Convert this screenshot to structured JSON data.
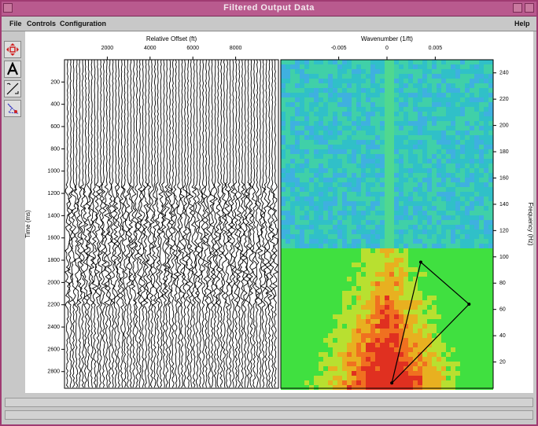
{
  "window": {
    "title": "Filtered Output Data"
  },
  "menu": {
    "file": "File",
    "controls": "Controls",
    "configuration": "Configuration",
    "help": "Help"
  },
  "toolbar": {
    "tools": [
      {
        "name": "pan-tool",
        "icon": "move-arrows-icon"
      },
      {
        "name": "annotate-tool",
        "icon": "letter-a-icon"
      },
      {
        "name": "line-tool",
        "icon": "line-draw-icon"
      },
      {
        "name": "polygon-tool",
        "icon": "polygon-select-icon"
      }
    ]
  },
  "chart_data": [
    {
      "type": "seismic-wiggle",
      "xlabel": "Relative Offset (ft)",
      "ylabel": "Time (ms)",
      "x_ticks": [
        2000,
        4000,
        6000,
        8000
      ],
      "y_ticks": [
        200,
        400,
        600,
        800,
        1000,
        1200,
        1400,
        1600,
        1800,
        2000,
        2200,
        2400,
        2600,
        2800
      ],
      "ylim": [
        0,
        2950
      ],
      "xlim": [
        0,
        10000
      ]
    },
    {
      "type": "heatmap",
      "xlabel": "Wavenumber (1/ft)",
      "ylabel": "Frequency (Hz)",
      "x_ticks": [
        "-0.005",
        "0",
        "0.005"
      ],
      "y_ticks": [
        240,
        220,
        200,
        180,
        160,
        140,
        120,
        100,
        80,
        60,
        40,
        20
      ],
      "xlim": [
        -0.011,
        0.011
      ],
      "ylim": [
        0,
        250
      ],
      "filter_polygon": [
        [
          0.0005,
          4
        ],
        [
          0.0035,
          96
        ],
        [
          0.0085,
          64
        ]
      ]
    }
  ]
}
